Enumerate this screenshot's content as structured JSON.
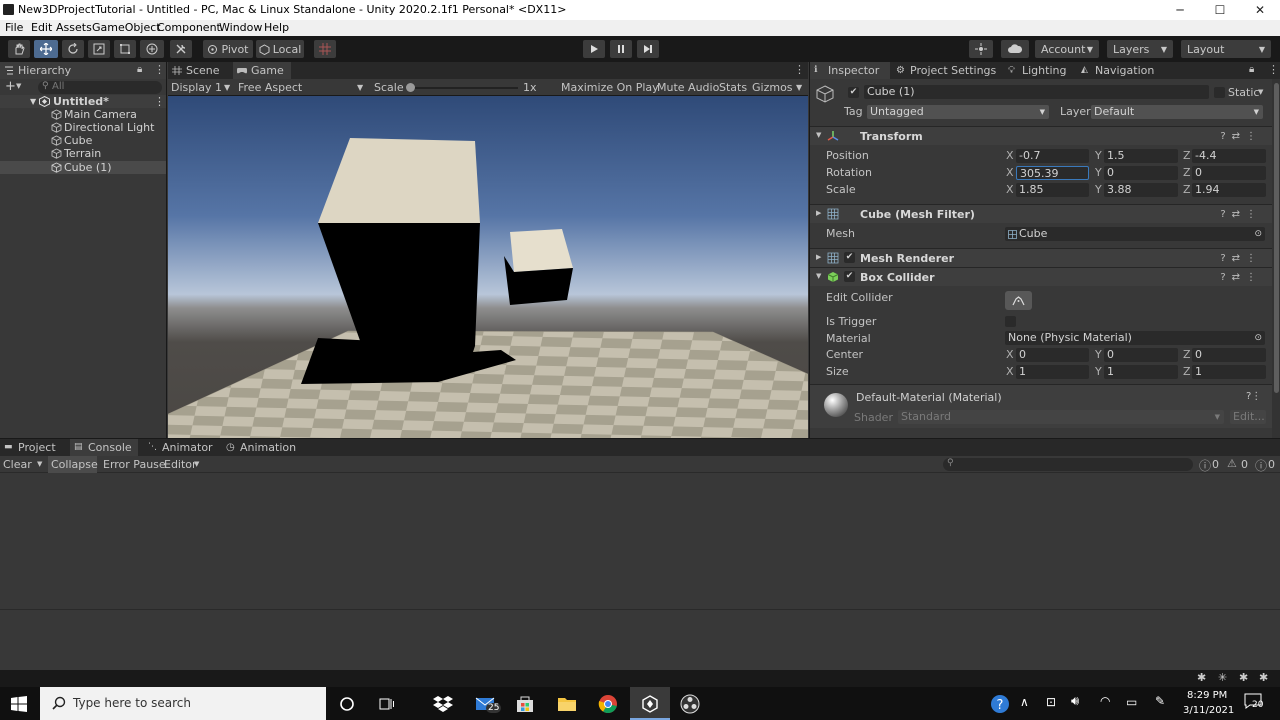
{
  "window": {
    "title": "New3DProjectTutorial - Untitled - PC, Mac & Linux Standalone - Unity 2020.2.1f1 Personal* <DX11>",
    "minimize": "─",
    "maximize": "☐",
    "close": "✕"
  },
  "menu": [
    "File",
    "Edit",
    "Assets",
    "GameObject",
    "Component",
    "Window",
    "Help"
  ],
  "toolbar": {
    "pivot": "Pivot",
    "local": "Local",
    "account": "Account",
    "layers": "Layers",
    "layout": "Layout"
  },
  "hierarchy": {
    "tab": "Hierarchy",
    "search_placeholder": "All",
    "scene": "Untitled*",
    "items": [
      "Main Camera",
      "Directional Light",
      "Cube",
      "Terrain",
      "Cube (1)"
    ]
  },
  "center_tabs": {
    "scene": "Scene",
    "game": "Game"
  },
  "game_bar": {
    "display": "Display 1",
    "aspect": "Free Aspect",
    "scale_label": "Scale",
    "scale_value": "1x",
    "scale_level": 0,
    "maximize": "Maximize On Play",
    "mute": "Mute Audio",
    "stats": "Stats",
    "gizmos": "Gizmos"
  },
  "inspector_tabs": [
    "Inspector",
    "Project Settings",
    "Lighting",
    "Navigation"
  ],
  "inspector": {
    "object_name": "Cube (1)",
    "static": "Static",
    "tag_label": "Tag",
    "tag_value": "Untagged",
    "layer_label": "Layer",
    "layer_value": "Default",
    "transform": {
      "title": "Transform",
      "position_label": "Position",
      "rotation_label": "Rotation",
      "scale_label": "Scale",
      "position": {
        "x": "-0.7",
        "y": "1.5",
        "z": "-4.4"
      },
      "rotation": {
        "x": "305.39",
        "y": "0",
        "z": "0"
      },
      "scale": {
        "x": "1.85",
        "y": "3.88",
        "z": "1.94"
      }
    },
    "mesh_filter": {
      "title": "Cube (Mesh Filter)",
      "mesh_label": "Mesh",
      "mesh_value": "Cube"
    },
    "mesh_renderer": {
      "title": "Mesh Renderer"
    },
    "box_collider": {
      "title": "Box Collider",
      "edit_collider": "Edit Collider",
      "is_trigger": "Is Trigger",
      "material_label": "Material",
      "material_value": "None (Physic Material)",
      "center_label": "Center",
      "size_label": "Size",
      "center": {
        "x": "0",
        "y": "0",
        "z": "0"
      },
      "size": {
        "x": "1",
        "y": "1",
        "z": "1"
      }
    },
    "material": {
      "title": "Default-Material (Material)",
      "shader_label": "Shader",
      "shader_value": "Standard",
      "edit": "Edit..."
    }
  },
  "axes": {
    "x": "X",
    "y": "Y",
    "z": "Z"
  },
  "bottom_tabs": [
    "Project",
    "Console",
    "Animator",
    "Animation"
  ],
  "console_bar": {
    "clear": "Clear",
    "collapse": "Collapse",
    "error_pause": "Error Pause",
    "editor": "Editor",
    "count_log": "0",
    "count_warn": "0",
    "count_error": "0"
  },
  "taskbar": {
    "search_placeholder": "Type here to search",
    "mail_badge": "25",
    "time": "8:29 PM",
    "date": "3/11/2021",
    "notifications": "20"
  }
}
